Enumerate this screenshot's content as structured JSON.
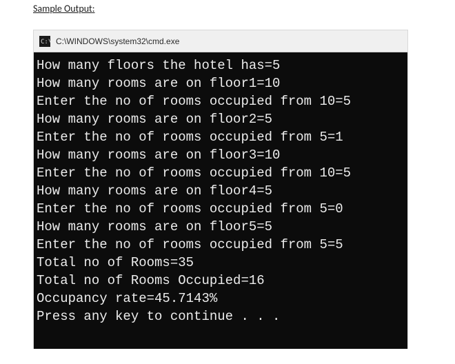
{
  "page": {
    "label_prefix": "Sample Output",
    "label_colon": ":"
  },
  "window": {
    "title": "C:\\WINDOWS\\system32\\cmd.exe",
    "icon_name": "cmd-icon"
  },
  "terminal": {
    "lines": [
      "How many floors the hotel has=5",
      "How many rooms are on floor1=10",
      "Enter the no of rooms occupied from 10=5",
      "How many rooms are on floor2=5",
      "Enter the no of rooms occupied from 5=1",
      "How many rooms are on floor3=10",
      "Enter the no of rooms occupied from 10=5",
      "How many rooms are on floor4=5",
      "Enter the no of rooms occupied from 5=0",
      "How many rooms are on floor5=5",
      "Enter the no of rooms occupied from 5=5",
      "Total no of Rooms=35",
      "Total no of Rooms Occupied=16",
      "Occupancy rate=45.7143%",
      "Press any key to continue . . ."
    ]
  }
}
